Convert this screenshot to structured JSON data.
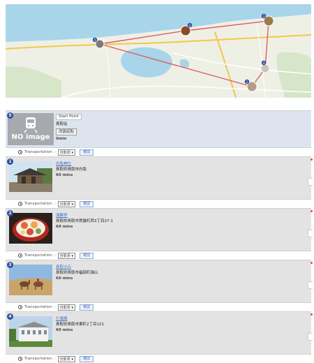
{
  "map": {
    "colors": {
      "sea": "#a9d5ea",
      "land": "#eef0e6",
      "lake": "#a9d5ea",
      "route": "#e05a61",
      "road": "#f5c64a",
      "marker_blue": "#2d4f9e"
    },
    "markers": [
      "1",
      "2",
      "3",
      "4",
      "5"
    ]
  },
  "start": {
    "number": "5",
    "image_text": "NO image",
    "label": "Start Point",
    "name": "鳥取站",
    "change_button": "改變起點",
    "duration": "0min"
  },
  "transport_label": "Transportation",
  "transport_select": "自動選",
  "transport_arrow": "▼",
  "set_button": "確認",
  "spots": [
    {
      "number": "1",
      "name": "白兔神社",
      "address": "鳥取県鳥取市白兔",
      "duration": "60 mins"
    },
    {
      "number": "2",
      "name": "海鮮亭",
      "address": "鳥取県鳥取市賀露町西3丁目27-1",
      "duration": "60 mins"
    },
    {
      "number": "3",
      "name": "鳥取沙丘",
      "address": "鳥取県鳥取市福部町湯山",
      "duration": "60 mins"
    },
    {
      "number": "4",
      "name": "仁風閣",
      "address": "鳥取県鳥取市東町2丁目121",
      "duration": "60 mins"
    }
  ]
}
